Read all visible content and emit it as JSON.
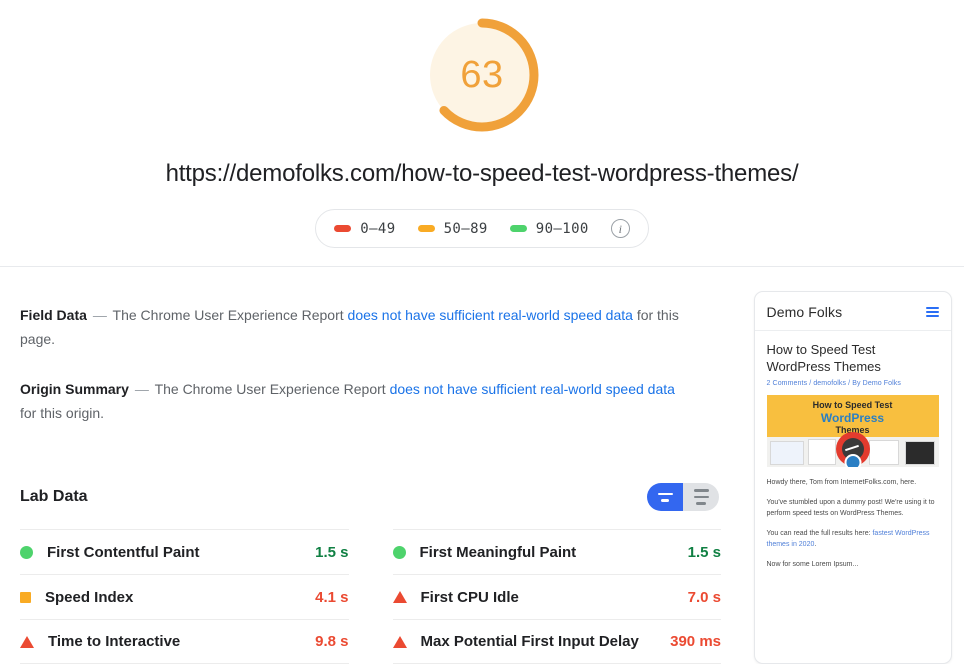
{
  "score": {
    "value": "63",
    "percent": 63,
    "color": "#f0a13a",
    "track_color": "#fdf4e4"
  },
  "page_url": "https://demofolks.com/how-to-speed-test-wordpress-themes/",
  "legend": {
    "items": [
      {
        "label": "0–49",
        "color": "#eb4a32",
        "name": "poor"
      },
      {
        "label": "50–89",
        "color": "#f9ab24",
        "name": "average"
      },
      {
        "label": "90–100",
        "color": "#4ed36c",
        "name": "good"
      }
    ],
    "info_glyph": "i"
  },
  "field_data": {
    "title": "Field Data",
    "dash": "—",
    "text_before": "The Chrome User Experience Report",
    "link": "does not have sufficient real-world speed data",
    "text_after": "for this page."
  },
  "origin_summary": {
    "title": "Origin Summary",
    "dash": "—",
    "text_before": "The Chrome User Experience Report",
    "link": "does not have sufficient real-world speed data",
    "text_after": "for this origin."
  },
  "lab_data": {
    "title": "Lab Data",
    "toggle": {
      "active_view": "detail-view",
      "inactive_view": "list-view",
      "active_color": "#3367f0",
      "inactive_color": "#e0e2e5"
    },
    "columns": [
      {
        "metrics": [
          {
            "name": "First Contentful Paint",
            "value": "1.5 s",
            "status": "good",
            "icon": "circle-icon",
            "value_class": "val-green"
          },
          {
            "name": "Speed Index",
            "value": "4.1 s",
            "status": "average",
            "icon": "square-icon",
            "value_class": "val-red"
          },
          {
            "name": "Time to Interactive",
            "value": "9.8 s",
            "status": "poor",
            "icon": "triangle-icon",
            "value_class": "val-red"
          }
        ]
      },
      {
        "metrics": [
          {
            "name": "First Meaningful Paint",
            "value": "1.5 s",
            "status": "good",
            "icon": "circle-icon",
            "value_class": "val-green"
          },
          {
            "name": "First CPU Idle",
            "value": "7.0 s",
            "status": "poor",
            "icon": "triangle-icon",
            "value_class": "val-red"
          },
          {
            "name": "Max Potential First Input Delay",
            "value": "390 ms",
            "status": "poor",
            "icon": "triangle-icon",
            "value_class": "val-red"
          }
        ]
      }
    ]
  },
  "preview": {
    "brand": "Demo Folks",
    "title": "How to Speed Test WordPress Themes",
    "meta": "2 Comments / demofolks / By Demo Folks",
    "thumbnail": {
      "line1": "How to Speed Test",
      "line2": "WordPress",
      "line3": "Themes"
    },
    "paragraphs": [
      {
        "text": "Howdy there, Tom from InternetFolks.com, here."
      },
      {
        "text": "You've stumbled upon a dummy post! We're using it to perform speed tests on WordPress Themes."
      },
      {
        "text": "You can read the full results here: ",
        "link": "fastest WordPress themes in 2020",
        "after": "."
      },
      {
        "text": "Now for some Lorem Ipsum..."
      }
    ]
  }
}
